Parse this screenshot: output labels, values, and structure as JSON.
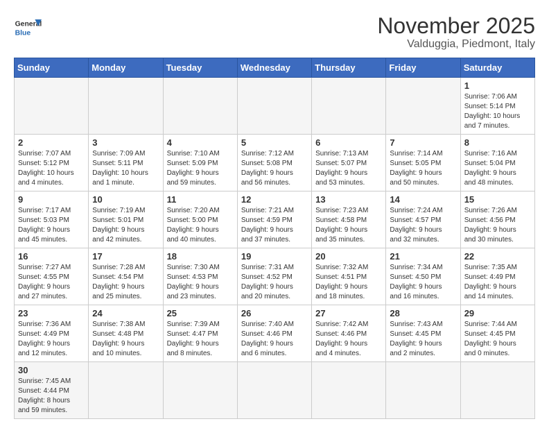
{
  "header": {
    "logo_general": "General",
    "logo_blue": "Blue",
    "title": "November 2025",
    "subtitle": "Valduggia, Piedmont, Italy"
  },
  "days_of_week": [
    "Sunday",
    "Monday",
    "Tuesday",
    "Wednesday",
    "Thursday",
    "Friday",
    "Saturday"
  ],
  "weeks": [
    [
      {
        "day": "",
        "info": "",
        "empty": true
      },
      {
        "day": "",
        "info": "",
        "empty": true
      },
      {
        "day": "",
        "info": "",
        "empty": true
      },
      {
        "day": "",
        "info": "",
        "empty": true
      },
      {
        "day": "",
        "info": "",
        "empty": true
      },
      {
        "day": "",
        "info": "",
        "empty": true
      },
      {
        "day": "1",
        "info": "Sunrise: 7:06 AM\nSunset: 5:14 PM\nDaylight: 10 hours\nand 7 minutes."
      }
    ],
    [
      {
        "day": "2",
        "info": "Sunrise: 7:07 AM\nSunset: 5:12 PM\nDaylight: 10 hours\nand 4 minutes."
      },
      {
        "day": "3",
        "info": "Sunrise: 7:09 AM\nSunset: 5:11 PM\nDaylight: 10 hours\nand 1 minute."
      },
      {
        "day": "4",
        "info": "Sunrise: 7:10 AM\nSunset: 5:09 PM\nDaylight: 9 hours\nand 59 minutes."
      },
      {
        "day": "5",
        "info": "Sunrise: 7:12 AM\nSunset: 5:08 PM\nDaylight: 9 hours\nand 56 minutes."
      },
      {
        "day": "6",
        "info": "Sunrise: 7:13 AM\nSunset: 5:07 PM\nDaylight: 9 hours\nand 53 minutes."
      },
      {
        "day": "7",
        "info": "Sunrise: 7:14 AM\nSunset: 5:05 PM\nDaylight: 9 hours\nand 50 minutes."
      },
      {
        "day": "8",
        "info": "Sunrise: 7:16 AM\nSunset: 5:04 PM\nDaylight: 9 hours\nand 48 minutes."
      }
    ],
    [
      {
        "day": "9",
        "info": "Sunrise: 7:17 AM\nSunset: 5:03 PM\nDaylight: 9 hours\nand 45 minutes."
      },
      {
        "day": "10",
        "info": "Sunrise: 7:19 AM\nSunset: 5:01 PM\nDaylight: 9 hours\nand 42 minutes."
      },
      {
        "day": "11",
        "info": "Sunrise: 7:20 AM\nSunset: 5:00 PM\nDaylight: 9 hours\nand 40 minutes."
      },
      {
        "day": "12",
        "info": "Sunrise: 7:21 AM\nSunset: 4:59 PM\nDaylight: 9 hours\nand 37 minutes."
      },
      {
        "day": "13",
        "info": "Sunrise: 7:23 AM\nSunset: 4:58 PM\nDaylight: 9 hours\nand 35 minutes."
      },
      {
        "day": "14",
        "info": "Sunrise: 7:24 AM\nSunset: 4:57 PM\nDaylight: 9 hours\nand 32 minutes."
      },
      {
        "day": "15",
        "info": "Sunrise: 7:26 AM\nSunset: 4:56 PM\nDaylight: 9 hours\nand 30 minutes."
      }
    ],
    [
      {
        "day": "16",
        "info": "Sunrise: 7:27 AM\nSunset: 4:55 PM\nDaylight: 9 hours\nand 27 minutes."
      },
      {
        "day": "17",
        "info": "Sunrise: 7:28 AM\nSunset: 4:54 PM\nDaylight: 9 hours\nand 25 minutes."
      },
      {
        "day": "18",
        "info": "Sunrise: 7:30 AM\nSunset: 4:53 PM\nDaylight: 9 hours\nand 23 minutes."
      },
      {
        "day": "19",
        "info": "Sunrise: 7:31 AM\nSunset: 4:52 PM\nDaylight: 9 hours\nand 20 minutes."
      },
      {
        "day": "20",
        "info": "Sunrise: 7:32 AM\nSunset: 4:51 PM\nDaylight: 9 hours\nand 18 minutes."
      },
      {
        "day": "21",
        "info": "Sunrise: 7:34 AM\nSunset: 4:50 PM\nDaylight: 9 hours\nand 16 minutes."
      },
      {
        "day": "22",
        "info": "Sunrise: 7:35 AM\nSunset: 4:49 PM\nDaylight: 9 hours\nand 14 minutes."
      }
    ],
    [
      {
        "day": "23",
        "info": "Sunrise: 7:36 AM\nSunset: 4:49 PM\nDaylight: 9 hours\nand 12 minutes."
      },
      {
        "day": "24",
        "info": "Sunrise: 7:38 AM\nSunset: 4:48 PM\nDaylight: 9 hours\nand 10 minutes."
      },
      {
        "day": "25",
        "info": "Sunrise: 7:39 AM\nSunset: 4:47 PM\nDaylight: 9 hours\nand 8 minutes."
      },
      {
        "day": "26",
        "info": "Sunrise: 7:40 AM\nSunset: 4:46 PM\nDaylight: 9 hours\nand 6 minutes."
      },
      {
        "day": "27",
        "info": "Sunrise: 7:42 AM\nSunset: 4:46 PM\nDaylight: 9 hours\nand 4 minutes."
      },
      {
        "day": "28",
        "info": "Sunrise: 7:43 AM\nSunset: 4:45 PM\nDaylight: 9 hours\nand 2 minutes."
      },
      {
        "day": "29",
        "info": "Sunrise: 7:44 AM\nSunset: 4:45 PM\nDaylight: 9 hours\nand 0 minutes."
      }
    ],
    [
      {
        "day": "30",
        "info": "Sunrise: 7:45 AM\nSunset: 4:44 PM\nDaylight: 8 hours\nand 59 minutes.",
        "last": true
      },
      {
        "day": "",
        "info": "",
        "empty": true,
        "last": true
      },
      {
        "day": "",
        "info": "",
        "empty": true,
        "last": true
      },
      {
        "day": "",
        "info": "",
        "empty": true,
        "last": true
      },
      {
        "day": "",
        "info": "",
        "empty": true,
        "last": true
      },
      {
        "day": "",
        "info": "",
        "empty": true,
        "last": true
      },
      {
        "day": "",
        "info": "",
        "empty": true,
        "last": true
      }
    ]
  ]
}
